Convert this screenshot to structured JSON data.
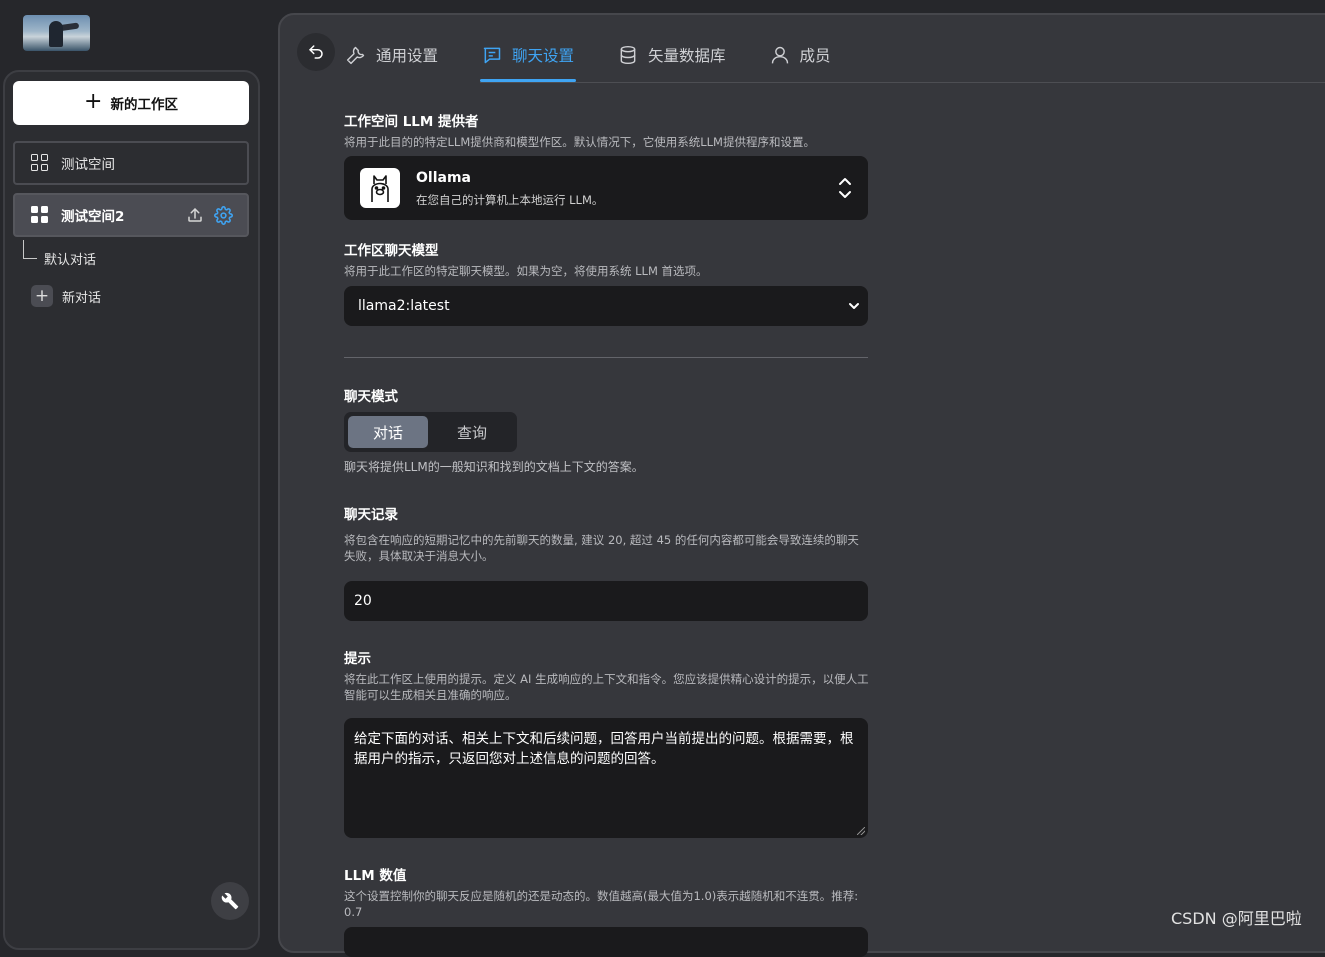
{
  "sidebar": {
    "new_workspace_label": "新的工作区",
    "workspaces": [
      {
        "name": "测试空间"
      },
      {
        "name": "测试空间2"
      }
    ],
    "threads": [
      {
        "name": "默认对话"
      }
    ],
    "new_thread_label": "新对话"
  },
  "tabs": [
    {
      "label": "通用设置",
      "icon": "wrench-icon"
    },
    {
      "label": "聊天设置",
      "icon": "chat-icon",
      "active": true
    },
    {
      "label": "矢量数据库",
      "icon": "database-icon"
    },
    {
      "label": "成员",
      "icon": "user-icon"
    }
  ],
  "settings": {
    "provider": {
      "title": "工作空间 LLM 提供者",
      "description": "将用于此目的的特定LLM提供商和模型作区。默认情况下，它使用系统LLM提供程序和设置。",
      "name": "Ollama",
      "subtitle": "在您自己的计算机上本地运行 LLM。"
    },
    "model": {
      "title": "工作区聊天模型",
      "description": "将用于此工作区的特定聊天模型。如果为空，将使用系统 LLM 首选项。",
      "value": "llama2:latest"
    },
    "mode": {
      "title": "聊天模式",
      "options": [
        "对话",
        "查询"
      ],
      "selected": "对话",
      "description": "聊天将提供LLM的一般知识和找到的文档上下文的答案。"
    },
    "history": {
      "title": "聊天记录",
      "description": "将包含在响应的短期记忆中的先前聊天的数量, 建议 20, 超过 45 的任何内容都可能会导致连续的聊天失败，具体取决于消息大小。",
      "value": "20"
    },
    "prompt": {
      "title": "提示",
      "description": "将在此工作区上使用的提示。定义 AI 生成响应的上下文和指令。您应该提供精心设计的提示，以便人工智能可以生成相关且准确的响应。",
      "value": "给定下面的对话、相关上下文和后续问题，回答用户当前提出的问题。根据需要，根据用户的指示，只返回您对上述信息的问题的回答。"
    },
    "temperature": {
      "title": "LLM 数值",
      "description": "这个设置控制你的聊天反应是随机的还是动态的。数值越高(最大值为1.0)表示越随机和不连贯。推荐: 0.7"
    }
  },
  "watermark": "CSDN @阿里巴啦",
  "colors": {
    "accent": "#3fa4f3",
    "panel": "#36373c",
    "sidebar": "#2c2d31",
    "field": "#1a1a1c"
  }
}
